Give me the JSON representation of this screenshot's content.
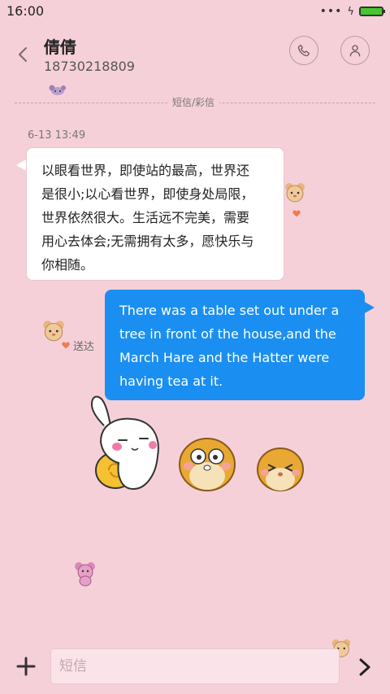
{
  "status_bar": {
    "time": "16:00",
    "icons": [
      "more-dots-icon",
      "charging-bolt-icon",
      "battery-icon"
    ],
    "battery_level": 1.0
  },
  "header": {
    "contact_name": "倩倩",
    "phone": "18730218809",
    "icons": [
      "back-arrow-icon",
      "phone-icon",
      "person-icon"
    ]
  },
  "thread": {
    "channel_label": "短信/彩信",
    "timestamp": "6-13 13:49",
    "incoming": {
      "lines": [
        "以眼看世界，即使站的最高，世界还",
        "是很小;以心看世界，即使身处局限，",
        "世界依然很大。生活远不完美，需要",
        "用心去体会;无需拥有太多，愿快乐与",
        "你相随。"
      ]
    },
    "outgoing": {
      "lines": [
        "There was a table set out under a",
        "tree in front of the house,and the",
        "March Hare and the Hatter were",
        "having tea at it."
      ],
      "status": "送达"
    }
  },
  "input": {
    "placeholder": "短信",
    "icons": [
      "plus-icon",
      "send-arrow-icon"
    ]
  },
  "colors": {
    "background": "#f6d0d9",
    "outgoing_bubble": "#1a8ff1",
    "incoming_bubble": "#ffffff",
    "battery": "#45c82b",
    "heart": "#f07a50"
  }
}
